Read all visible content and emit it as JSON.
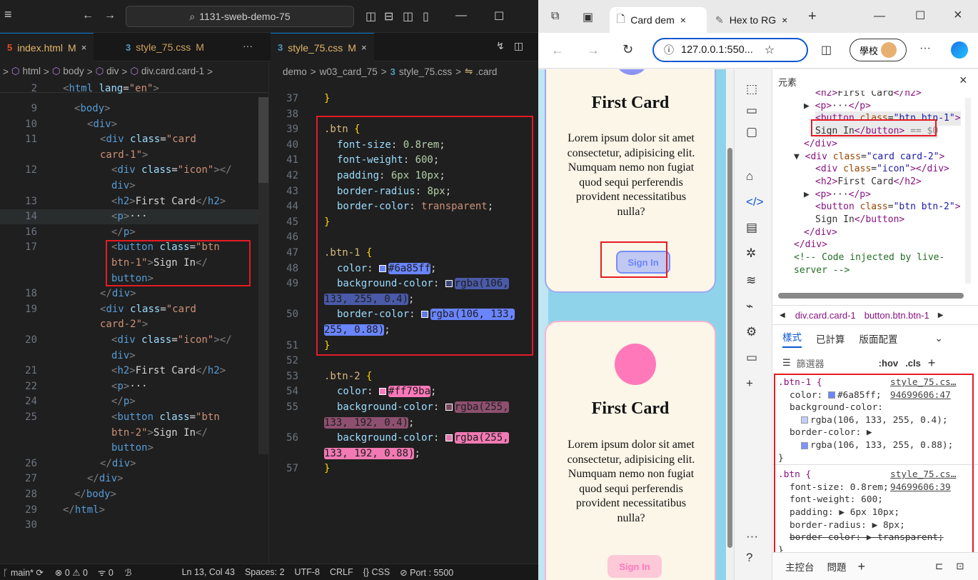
{
  "vscode": {
    "search_text": "1131-sweb-demo-75",
    "tabs_left": [
      {
        "icon": "5",
        "label": "index.html",
        "status": "M",
        "close": "×"
      },
      {
        "icon": "3",
        "label": "style_75.css",
        "status": "M"
      }
    ],
    "tabs_right": [
      {
        "icon": "3",
        "label": "style_75.css",
        "status": "M",
        "close": "×"
      }
    ],
    "more": "···",
    "breadcrumb_left": [
      ">",
      "html",
      ">",
      "body",
      ">",
      "div",
      ">",
      "div.card.card-1",
      ">"
    ],
    "breadcrumb_right": [
      "demo",
      ">",
      "w03_card_75",
      ">",
      "style_75.css",
      ">",
      ".card"
    ],
    "status": {
      "branch": "main*",
      "problems_err": "0",
      "problems_warn": "0",
      "ports": "0",
      "position": "Ln 13, Col 43",
      "spaces": "Spaces: 2",
      "encoding": "UTF-8",
      "eol": "CRLF",
      "lang": "CSS",
      "port": "Port : 5500"
    }
  },
  "browser": {
    "tabs": [
      {
        "label": "Card dem",
        "close": "×"
      },
      {
        "label": "Hex to RG",
        "close": "×"
      }
    ],
    "url": "127.0.0.1:550...",
    "profile": "學校",
    "cards": [
      {
        "title": "First Card",
        "text": "Lorem ipsum dolor sit amet consectetur, adipisicing elit. Numquam nemo non fugiat quod sequi perferendis provident necessitatibus nulla?",
        "button": "Sign In"
      },
      {
        "title": "First Card",
        "text": "Lorem ipsum dolor sit amet consectetur, adipisicing elit. Numquam nemo non fugiat quod sequi perferendis provident necessitatibus nulla?",
        "button": "Sign In"
      }
    ]
  },
  "devtools": {
    "title": "元素",
    "crumbs": [
      "div.card.card-1",
      "button.btn.btn-1"
    ],
    "tabs": [
      "樣式",
      "已計算",
      "版面配置"
    ],
    "filter": "篩選器",
    "hov": ":hov",
    "cls": ".cls",
    "rule1_selector": ".btn-1 {",
    "rule1_link": "style_75.cs…94699606:47",
    "rule2_selector": ".btn {",
    "rule2_link": "style_75.cs…94699606:39",
    "bottom_tabs": [
      "主控台",
      "問題"
    ]
  }
}
